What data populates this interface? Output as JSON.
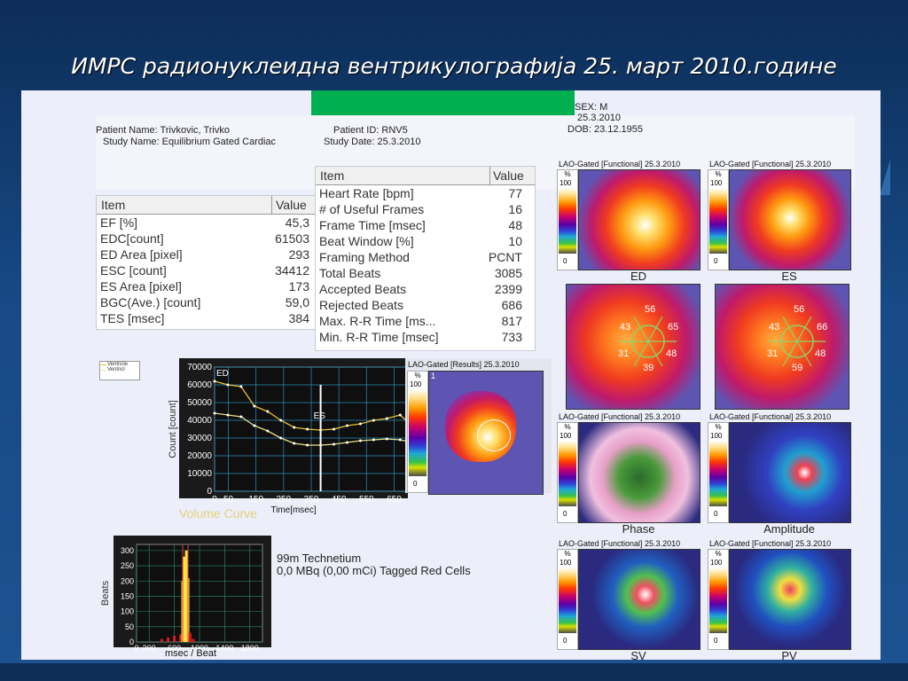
{
  "slide": {
    "title": "ИМРС радионуклеидна вентрикулографија 25. март 2010.године"
  },
  "header": {
    "patient_name": "Patient Name: Trivkovic, Trivko",
    "study_name": "Study Name: Equilibrium Gated Cardiac",
    "patient_id": "Patient ID: RNV5",
    "study_date": "Study Date: 25.3.2010",
    "sex": "SEX: M",
    "date": "25.3.2010",
    "dob": "DOB: 23.12.1955"
  },
  "table_left": {
    "col_item": "Item",
    "col_value": "Value",
    "rows": [
      {
        "item": "EF [%]",
        "value": "45,3"
      },
      {
        "item": "EDC[count]",
        "value": "61503"
      },
      {
        "item": "ED Area [pixel]",
        "value": "293"
      },
      {
        "item": "ESC [count]",
        "value": "34412"
      },
      {
        "item": "ES Area [pixel]",
        "value": "173"
      },
      {
        "item": "BGC(Ave.) [count]",
        "value": "59,0"
      },
      {
        "item": "TES [msec]",
        "value": "384"
      }
    ]
  },
  "table_mid": {
    "col_item": "Item",
    "col_value": "Value",
    "rows": [
      {
        "item": "Heart Rate [bpm]",
        "value": "77"
      },
      {
        "item": "# of Useful Frames",
        "value": "16"
      },
      {
        "item": "Frame Time [msec]",
        "value": "48"
      },
      {
        "item": "Beat Window [%]",
        "value": "10"
      },
      {
        "item": "Framing Method",
        "value": "PCNT"
      },
      {
        "item": "Total Beats",
        "value": "3085"
      },
      {
        "item": "Accepted Beats",
        "value": "2399"
      },
      {
        "item": "Rejected Beats",
        "value": "686"
      },
      {
        "item": "Max. R-R Time [ms...",
        "value": "817"
      },
      {
        "item": "Min. R-R Time [msec]",
        "value": "733"
      }
    ]
  },
  "volume_chart": {
    "legend": [
      "Ventricle",
      "Ventricl"
    ],
    "ylabel": "Count [count]",
    "xlabel": "Time[msec]",
    "caption": "Volume Curve",
    "yticks": [
      "70000",
      "60000",
      "50000",
      "40000",
      "30000",
      "20000",
      "10000",
      "0"
    ],
    "xticks": [
      "0",
      "50",
      "150",
      "250",
      "350",
      "450",
      "550",
      "650"
    ],
    "ed_label": "ED",
    "es_label": "ES"
  },
  "histogram": {
    "ylabel": "Beats",
    "xlabel": "msec / Beat",
    "yticks": [
      "300",
      "250",
      "200",
      "150",
      "100",
      "50",
      "0"
    ],
    "xticks": [
      "0",
      "200",
      "600",
      "1000",
      "1400",
      "1800"
    ]
  },
  "isotope": {
    "line1": "99m Technetium",
    "line2": "0,0 MBq (0,00 mCi) Tagged Red Cells"
  },
  "images": {
    "functional_title": "LAO-Gated [Functional] 25.3.2010",
    "results_title": "LAO-Gated [Results] 25.3.2010",
    "percent": "%",
    "scale_max": "100",
    "scale_min": "0",
    "results_frame": "1",
    "cap_ed": "ED",
    "cap_es": "ES",
    "cap_phase": "Phase",
    "cap_amplitude": "Amplitude",
    "cap_sv": "SV",
    "cap_pv": "PV",
    "sector_ed": [
      "43",
      "56",
      "65",
      "48",
      "31",
      "39"
    ],
    "sector_es": [
      "43",
      "56",
      "66",
      "48",
      "31",
      "59"
    ]
  },
  "chart_data": [
    {
      "type": "line",
      "title": "",
      "caption": "Volume Curve",
      "xlabel": "Time[msec]",
      "ylabel": "Count [count]",
      "ylim": [
        0,
        70000
      ],
      "xlim": [
        0,
        700
      ],
      "series": [
        {
          "name": "Ventricle",
          "x": [
            0,
            48,
            96,
            144,
            192,
            240,
            288,
            336,
            384,
            432,
            480,
            528,
            576,
            624,
            672,
            700
          ],
          "values": [
            62000,
            60000,
            59000,
            48000,
            45000,
            40000,
            36000,
            35000,
            34500,
            35000,
            37000,
            38000,
            40000,
            41000,
            43000,
            39000
          ]
        },
        {
          "name": "Ventricl",
          "x": [
            0,
            48,
            96,
            144,
            192,
            240,
            288,
            336,
            384,
            432,
            480,
            528,
            576,
            624,
            672,
            700
          ],
          "values": [
            44000,
            43000,
            42000,
            37000,
            34000,
            30000,
            27000,
            26000,
            26000,
            26500,
            27500,
            28500,
            29000,
            29500,
            29000,
            28000
          ]
        }
      ],
      "grid": true
    },
    {
      "type": "bar",
      "title": "",
      "xlabel": "msec / Beat",
      "ylabel": "Beats",
      "ylim": [
        0,
        320
      ],
      "xlim": [
        0,
        2000
      ],
      "x": [
        400,
        500,
        600,
        700,
        733,
        760,
        790,
        817,
        850,
        900
      ],
      "values": [
        10,
        15,
        20,
        25,
        200,
        280,
        300,
        210,
        30,
        10
      ],
      "grid": true
    }
  ]
}
